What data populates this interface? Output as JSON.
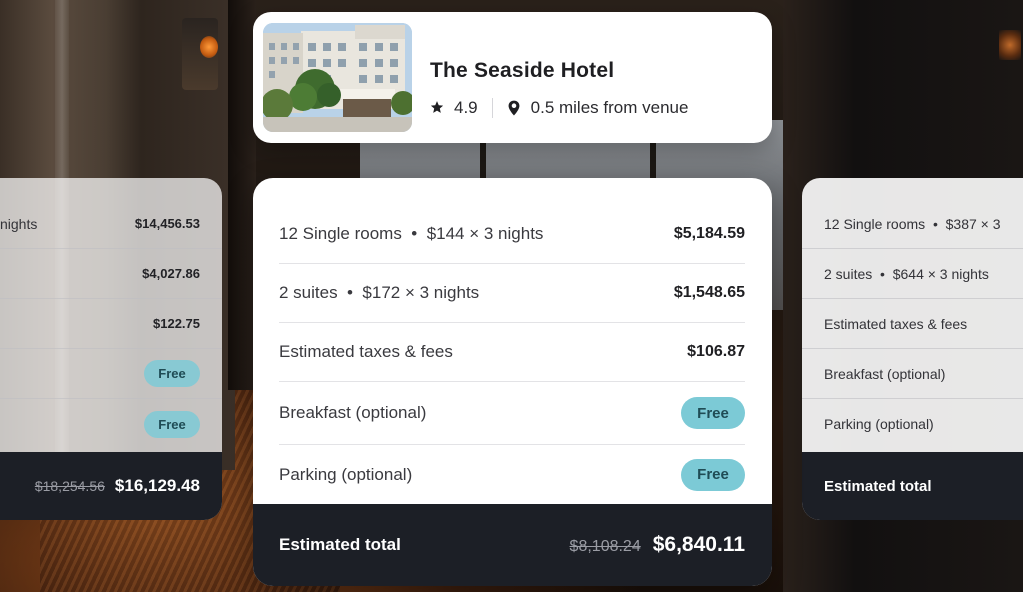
{
  "hotel": {
    "name": "The Seaside Hotel",
    "rating": "4.9",
    "distance": "0.5 miles from venue"
  },
  "price_card": {
    "rows": [
      {
        "label": "12 Single rooms  •  $144 × 3 nights",
        "amount": "$5,184.59"
      },
      {
        "label": "2 suites  •  $172 × 3 nights",
        "amount": "$1,548.65"
      },
      {
        "label": "Estimated taxes & fees",
        "amount": "$106.87"
      },
      {
        "label": "Breakfast (optional)",
        "badge": "Free"
      },
      {
        "label": "Parking (optional)",
        "badge": "Free"
      }
    ],
    "total_label": "Estimated total",
    "total_old": "$8,108.24",
    "total_new": "$6,840.11"
  },
  "left_card": {
    "rows": [
      {
        "label": "nights",
        "amount": "$14,456.53"
      },
      {
        "amount": "$4,027.86"
      },
      {
        "amount": "$122.75"
      },
      {
        "badge": "Free"
      },
      {
        "badge": "Free"
      }
    ],
    "total_old": "$18,254.56",
    "total_new": "$16,129.48"
  },
  "right_card": {
    "rows": [
      {
        "label": "12 Single rooms  •  $387 × 3"
      },
      {
        "label": "2 suites  •  $644 × 3 nights"
      },
      {
        "label": "Estimated taxes & fees"
      },
      {
        "label": "Breakfast (optional)"
      },
      {
        "label": "Parking (optional)"
      }
    ],
    "total_label": "Estimated total"
  },
  "colors": {
    "badge": "#7ccad6",
    "total_bar": "#1c1f26"
  }
}
